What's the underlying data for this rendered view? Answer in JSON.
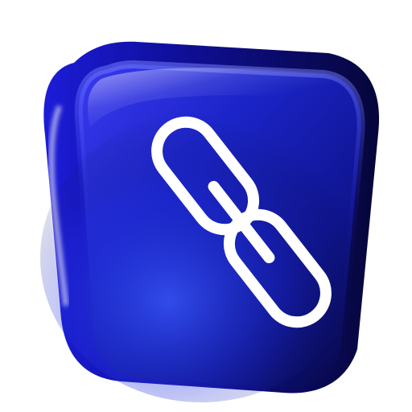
{
  "icon": {
    "name": "link-icon",
    "button_name": "link-button"
  },
  "colors": {
    "background": "#ffffff",
    "button_deep": "#0a0a4a",
    "button_mid": "#12127f",
    "button_bright": "#1f2fd6",
    "highlight": "#6f78ff",
    "link_stroke": "#ffffff"
  }
}
